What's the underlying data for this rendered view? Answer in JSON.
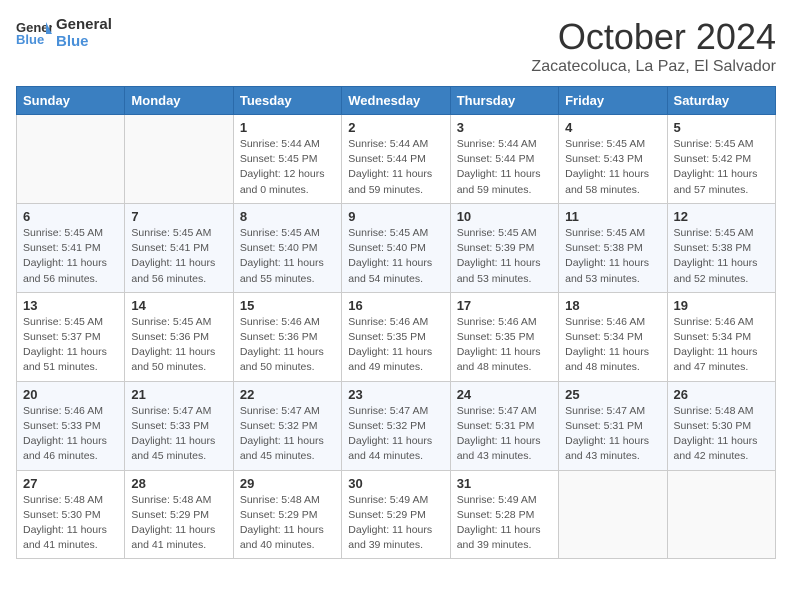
{
  "header": {
    "logo_line1": "General",
    "logo_line2": "Blue",
    "month": "October 2024",
    "location": "Zacatecoluca, La Paz, El Salvador"
  },
  "weekdays": [
    "Sunday",
    "Monday",
    "Tuesday",
    "Wednesday",
    "Thursday",
    "Friday",
    "Saturday"
  ],
  "weeks": [
    [
      {
        "day": "",
        "info": ""
      },
      {
        "day": "",
        "info": ""
      },
      {
        "day": "1",
        "info": "Sunrise: 5:44 AM\nSunset: 5:45 PM\nDaylight: 12 hours\nand 0 minutes."
      },
      {
        "day": "2",
        "info": "Sunrise: 5:44 AM\nSunset: 5:44 PM\nDaylight: 11 hours\nand 59 minutes."
      },
      {
        "day": "3",
        "info": "Sunrise: 5:44 AM\nSunset: 5:44 PM\nDaylight: 11 hours\nand 59 minutes."
      },
      {
        "day": "4",
        "info": "Sunrise: 5:45 AM\nSunset: 5:43 PM\nDaylight: 11 hours\nand 58 minutes."
      },
      {
        "day": "5",
        "info": "Sunrise: 5:45 AM\nSunset: 5:42 PM\nDaylight: 11 hours\nand 57 minutes."
      }
    ],
    [
      {
        "day": "6",
        "info": "Sunrise: 5:45 AM\nSunset: 5:41 PM\nDaylight: 11 hours\nand 56 minutes."
      },
      {
        "day": "7",
        "info": "Sunrise: 5:45 AM\nSunset: 5:41 PM\nDaylight: 11 hours\nand 56 minutes."
      },
      {
        "day": "8",
        "info": "Sunrise: 5:45 AM\nSunset: 5:40 PM\nDaylight: 11 hours\nand 55 minutes."
      },
      {
        "day": "9",
        "info": "Sunrise: 5:45 AM\nSunset: 5:40 PM\nDaylight: 11 hours\nand 54 minutes."
      },
      {
        "day": "10",
        "info": "Sunrise: 5:45 AM\nSunset: 5:39 PM\nDaylight: 11 hours\nand 53 minutes."
      },
      {
        "day": "11",
        "info": "Sunrise: 5:45 AM\nSunset: 5:38 PM\nDaylight: 11 hours\nand 53 minutes."
      },
      {
        "day": "12",
        "info": "Sunrise: 5:45 AM\nSunset: 5:38 PM\nDaylight: 11 hours\nand 52 minutes."
      }
    ],
    [
      {
        "day": "13",
        "info": "Sunrise: 5:45 AM\nSunset: 5:37 PM\nDaylight: 11 hours\nand 51 minutes."
      },
      {
        "day": "14",
        "info": "Sunrise: 5:45 AM\nSunset: 5:36 PM\nDaylight: 11 hours\nand 50 minutes."
      },
      {
        "day": "15",
        "info": "Sunrise: 5:46 AM\nSunset: 5:36 PM\nDaylight: 11 hours\nand 50 minutes."
      },
      {
        "day": "16",
        "info": "Sunrise: 5:46 AM\nSunset: 5:35 PM\nDaylight: 11 hours\nand 49 minutes."
      },
      {
        "day": "17",
        "info": "Sunrise: 5:46 AM\nSunset: 5:35 PM\nDaylight: 11 hours\nand 48 minutes."
      },
      {
        "day": "18",
        "info": "Sunrise: 5:46 AM\nSunset: 5:34 PM\nDaylight: 11 hours\nand 48 minutes."
      },
      {
        "day": "19",
        "info": "Sunrise: 5:46 AM\nSunset: 5:34 PM\nDaylight: 11 hours\nand 47 minutes."
      }
    ],
    [
      {
        "day": "20",
        "info": "Sunrise: 5:46 AM\nSunset: 5:33 PM\nDaylight: 11 hours\nand 46 minutes."
      },
      {
        "day": "21",
        "info": "Sunrise: 5:47 AM\nSunset: 5:33 PM\nDaylight: 11 hours\nand 45 minutes."
      },
      {
        "day": "22",
        "info": "Sunrise: 5:47 AM\nSunset: 5:32 PM\nDaylight: 11 hours\nand 45 minutes."
      },
      {
        "day": "23",
        "info": "Sunrise: 5:47 AM\nSunset: 5:32 PM\nDaylight: 11 hours\nand 44 minutes."
      },
      {
        "day": "24",
        "info": "Sunrise: 5:47 AM\nSunset: 5:31 PM\nDaylight: 11 hours\nand 43 minutes."
      },
      {
        "day": "25",
        "info": "Sunrise: 5:47 AM\nSunset: 5:31 PM\nDaylight: 11 hours\nand 43 minutes."
      },
      {
        "day": "26",
        "info": "Sunrise: 5:48 AM\nSunset: 5:30 PM\nDaylight: 11 hours\nand 42 minutes."
      }
    ],
    [
      {
        "day": "27",
        "info": "Sunrise: 5:48 AM\nSunset: 5:30 PM\nDaylight: 11 hours\nand 41 minutes."
      },
      {
        "day": "28",
        "info": "Sunrise: 5:48 AM\nSunset: 5:29 PM\nDaylight: 11 hours\nand 41 minutes."
      },
      {
        "day": "29",
        "info": "Sunrise: 5:48 AM\nSunset: 5:29 PM\nDaylight: 11 hours\nand 40 minutes."
      },
      {
        "day": "30",
        "info": "Sunrise: 5:49 AM\nSunset: 5:29 PM\nDaylight: 11 hours\nand 39 minutes."
      },
      {
        "day": "31",
        "info": "Sunrise: 5:49 AM\nSunset: 5:28 PM\nDaylight: 11 hours\nand 39 minutes."
      },
      {
        "day": "",
        "info": ""
      },
      {
        "day": "",
        "info": ""
      }
    ]
  ]
}
